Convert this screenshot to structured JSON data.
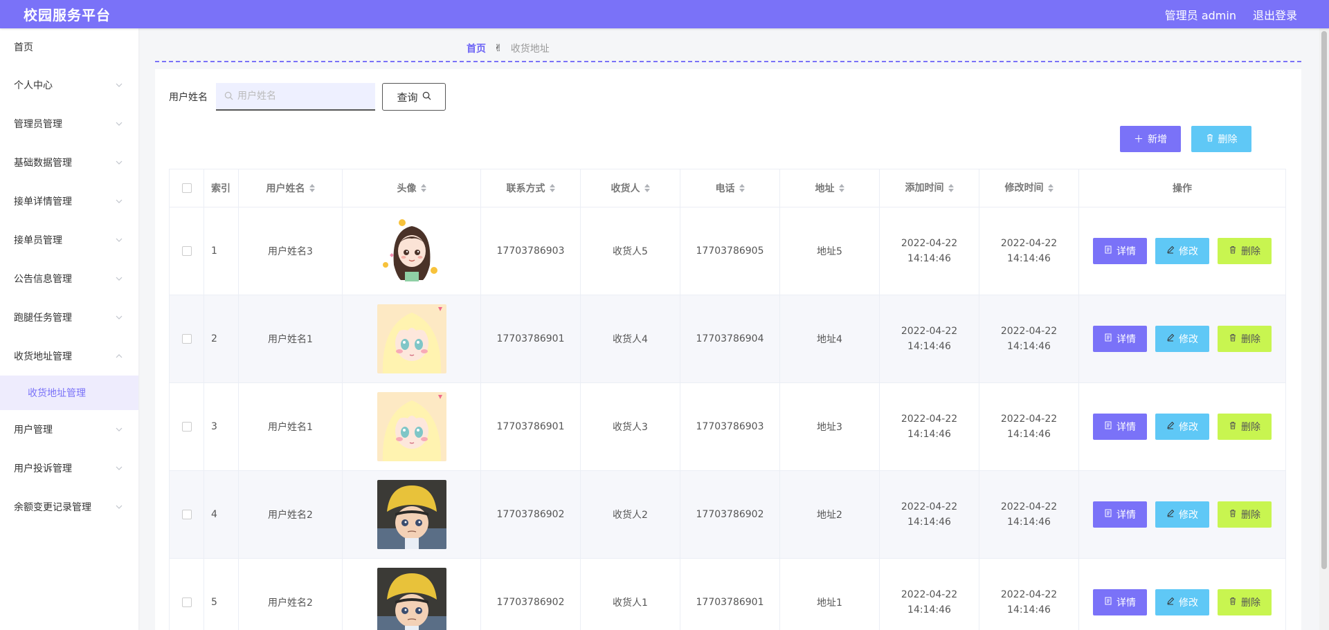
{
  "header": {
    "brand": "校园服务平台",
    "user_label": "管理员 admin",
    "logout_label": "退出登录"
  },
  "sidebar": {
    "items": [
      {
        "label": "首页"
      },
      {
        "label": "个人中心"
      },
      {
        "label": "管理员管理"
      },
      {
        "label": "基础数据管理"
      },
      {
        "label": "接单详情管理"
      },
      {
        "label": "接单员管理"
      },
      {
        "label": "公告信息管理"
      },
      {
        "label": "跑腿任务管理"
      },
      {
        "label": "收货地址管理"
      },
      {
        "label": "用户管理"
      },
      {
        "label": "用户投诉管理"
      },
      {
        "label": "余额变更记录管理"
      }
    ],
    "active_sub": "收货地址管理"
  },
  "breadcrumb": {
    "home": "首页",
    "separator": "✌",
    "current": "收货地址"
  },
  "search": {
    "label": "用户姓名",
    "placeholder": "用户姓名",
    "value": "",
    "button_label": "查询"
  },
  "actions": {
    "add_label": "新增",
    "delete_label": "删除"
  },
  "table": {
    "columns": [
      "索引",
      "用户姓名",
      "头像",
      "联系方式",
      "收货人",
      "电话",
      "地址",
      "添加时间",
      "修改时间",
      "操作"
    ],
    "rows": [
      {
        "index": "1",
        "name": "用户姓名3",
        "avatar": "girl-dark-hair",
        "contact": "17703786903",
        "receiver": "收货人5",
        "phone": "17703786905",
        "address": "地址5",
        "added": "2022-04-22 14:14:46",
        "modified": "2022-04-22 14:14:46"
      },
      {
        "index": "2",
        "name": "用户姓名1",
        "avatar": "girl-blonde",
        "contact": "17703786901",
        "receiver": "收货人4",
        "phone": "17703786904",
        "address": "地址4",
        "added": "2022-04-22 14:14:46",
        "modified": "2022-04-22 14:14:46"
      },
      {
        "index": "3",
        "name": "用户姓名1",
        "avatar": "girl-blonde",
        "contact": "17703786901",
        "receiver": "收货人3",
        "phone": "17703786903",
        "address": "地址3",
        "added": "2022-04-22 14:14:46",
        "modified": "2022-04-22 14:14:46"
      },
      {
        "index": "4",
        "name": "用户姓名2",
        "avatar": "boy-yellow-hat",
        "contact": "17703786902",
        "receiver": "收货人2",
        "phone": "17703786902",
        "address": "地址2",
        "added": "2022-04-22 14:14:46",
        "modified": "2022-04-22 14:14:46"
      },
      {
        "index": "5",
        "name": "用户姓名2",
        "avatar": "boy-yellow-hat",
        "contact": "17703786902",
        "receiver": "收货人1",
        "phone": "17703786901",
        "address": "地址1",
        "added": "2022-04-22 14:14:46",
        "modified": "2022-04-22 14:14:46"
      }
    ],
    "op_labels": {
      "detail": "详情",
      "edit": "修改",
      "delete": "删除"
    }
  },
  "colors": {
    "primary": "#7a72f8",
    "info": "#5fc8f6",
    "lime": "#c8f550"
  }
}
